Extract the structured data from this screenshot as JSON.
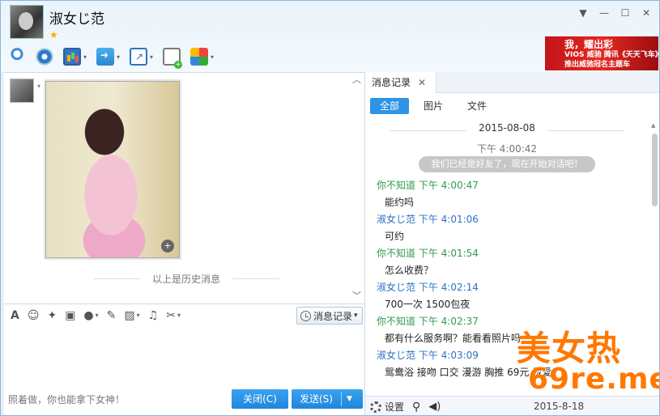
{
  "header": {
    "contact_name": "淑女じ范",
    "star": "★",
    "win_controls": [
      "▼",
      "—",
      "☐",
      "✕"
    ]
  },
  "ad_banner": {
    "lines": [
      "我，耀出彩",
      "VIOS 威驰 腾讯《天天飞车》",
      "推出威驰冠名主题车"
    ]
  },
  "toolbar": {
    "items": [
      {
        "name": "voice-call-icon",
        "dropdown": false
      },
      {
        "name": "video-call-icon",
        "dropdown": false
      },
      {
        "name": "screen-share-icon",
        "dropdown": true
      },
      {
        "name": "send-file-icon",
        "dropdown": true
      },
      {
        "name": "remote-desktop-icon",
        "dropdown": true
      },
      {
        "name": "add-chat-icon",
        "dropdown": false
      },
      {
        "name": "apps-icon",
        "dropdown": true
      }
    ]
  },
  "chat": {
    "history_separator": "以上是历史消息",
    "collapse_up": "︿",
    "collapse_down": "﹀",
    "zoom_glyph": "+"
  },
  "input_toolbar": {
    "history_button": "消息记录",
    "dropdown_glyph": "▾"
  },
  "input": {
    "text": "照着做，你也能拿下女神！",
    "close_label": "关闭(C)",
    "send_label": "发送(S)",
    "send_dropdown": "▼"
  },
  "history_panel": {
    "tab_label": "消息记录",
    "tab_close": "✕",
    "filters": [
      "全部",
      "图片",
      "文件"
    ],
    "active_filter": "全部",
    "date": "2015-08-08",
    "system_time": "下午 4:00:42",
    "system_message": "我们已经是好友了，现在开始对话吧！",
    "messages": [
      {
        "sender": "你不知道",
        "time": "下午 4:00:47",
        "side": "other",
        "text": "能约吗"
      },
      {
        "sender": "淑女じ范",
        "time": "下午 4:01:06",
        "side": "me",
        "text": "可约"
      },
      {
        "sender": "你不知道",
        "time": "下午 4:01:54",
        "side": "other",
        "text": "怎么收费？"
      },
      {
        "sender": "淑女じ范",
        "time": "下午 4:02:14",
        "side": "me",
        "text": "700一次 1500包夜"
      },
      {
        "sender": "你不知道",
        "time": "下午 4:02:37",
        "side": "other",
        "text": "都有什么服务啊？能看看照片吗"
      },
      {
        "sender": "淑女じ范",
        "time": "下午 4:03:09",
        "side": "me",
        "text": "鸳鸯浴 接吻 口交 漫游 胸推 69元 做爱"
      }
    ],
    "settings_label": "设置",
    "bottom_date": "2015-8-18"
  },
  "watermark": {
    "line1": "美女热",
    "line2": "69re.me"
  },
  "colors": {
    "accent": "#2f93e6",
    "other_sender": "#2f9b4f",
    "self_sender": "#2d72c4",
    "watermark": "#ff7800"
  }
}
